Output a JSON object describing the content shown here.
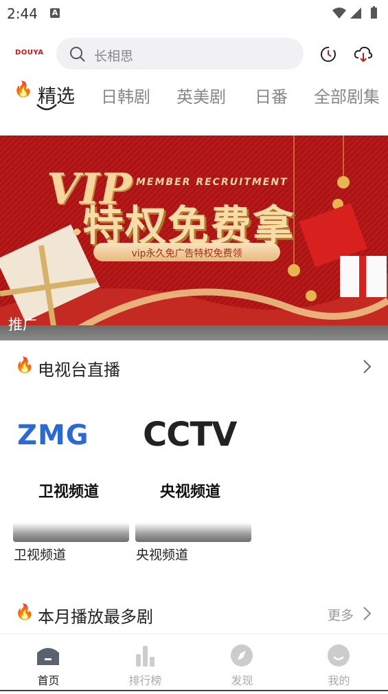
{
  "status": {
    "time": "2:44",
    "notif_letter": "A"
  },
  "header": {
    "logo": "DOUYA",
    "search_placeholder": "长相思",
    "icons": [
      "history-icon",
      "cloud-download-icon"
    ]
  },
  "tabs": [
    {
      "label": "精选",
      "active": true
    },
    {
      "label": "日韩剧",
      "active": false
    },
    {
      "label": "英美剧",
      "active": false
    },
    {
      "label": "日番",
      "active": false
    },
    {
      "label": "全部剧集",
      "active": false
    }
  ],
  "banner": {
    "vip": "VIP",
    "title": "特权免费拿",
    "subtitle": "MEMBER RECRUITMENT",
    "pill": "vip永久免广告特权免费领",
    "tag": "推广"
  },
  "live_section": {
    "title": "电视台直播",
    "channels": [
      {
        "logo": "ZMG",
        "caption": "卫视频道",
        "label": "卫视频道"
      },
      {
        "logo": "CCTV",
        "caption": "央视频道",
        "label": "央视频道"
      }
    ]
  },
  "top_section": {
    "title": "本月播放最多剧",
    "more": "更多"
  },
  "bottom_nav": [
    {
      "label": "首页",
      "icon": "home-icon",
      "active": true
    },
    {
      "label": "排行榜",
      "icon": "chart-icon",
      "active": false
    },
    {
      "label": "发现",
      "icon": "compass-icon",
      "active": false
    },
    {
      "label": "我的",
      "icon": "profile-icon",
      "active": false
    }
  ],
  "colors": {
    "brand_red": "#d01515",
    "banner_red": "#b81a1a",
    "zmg_blue": "#2b6ad6",
    "gold": "#f6d69b"
  }
}
